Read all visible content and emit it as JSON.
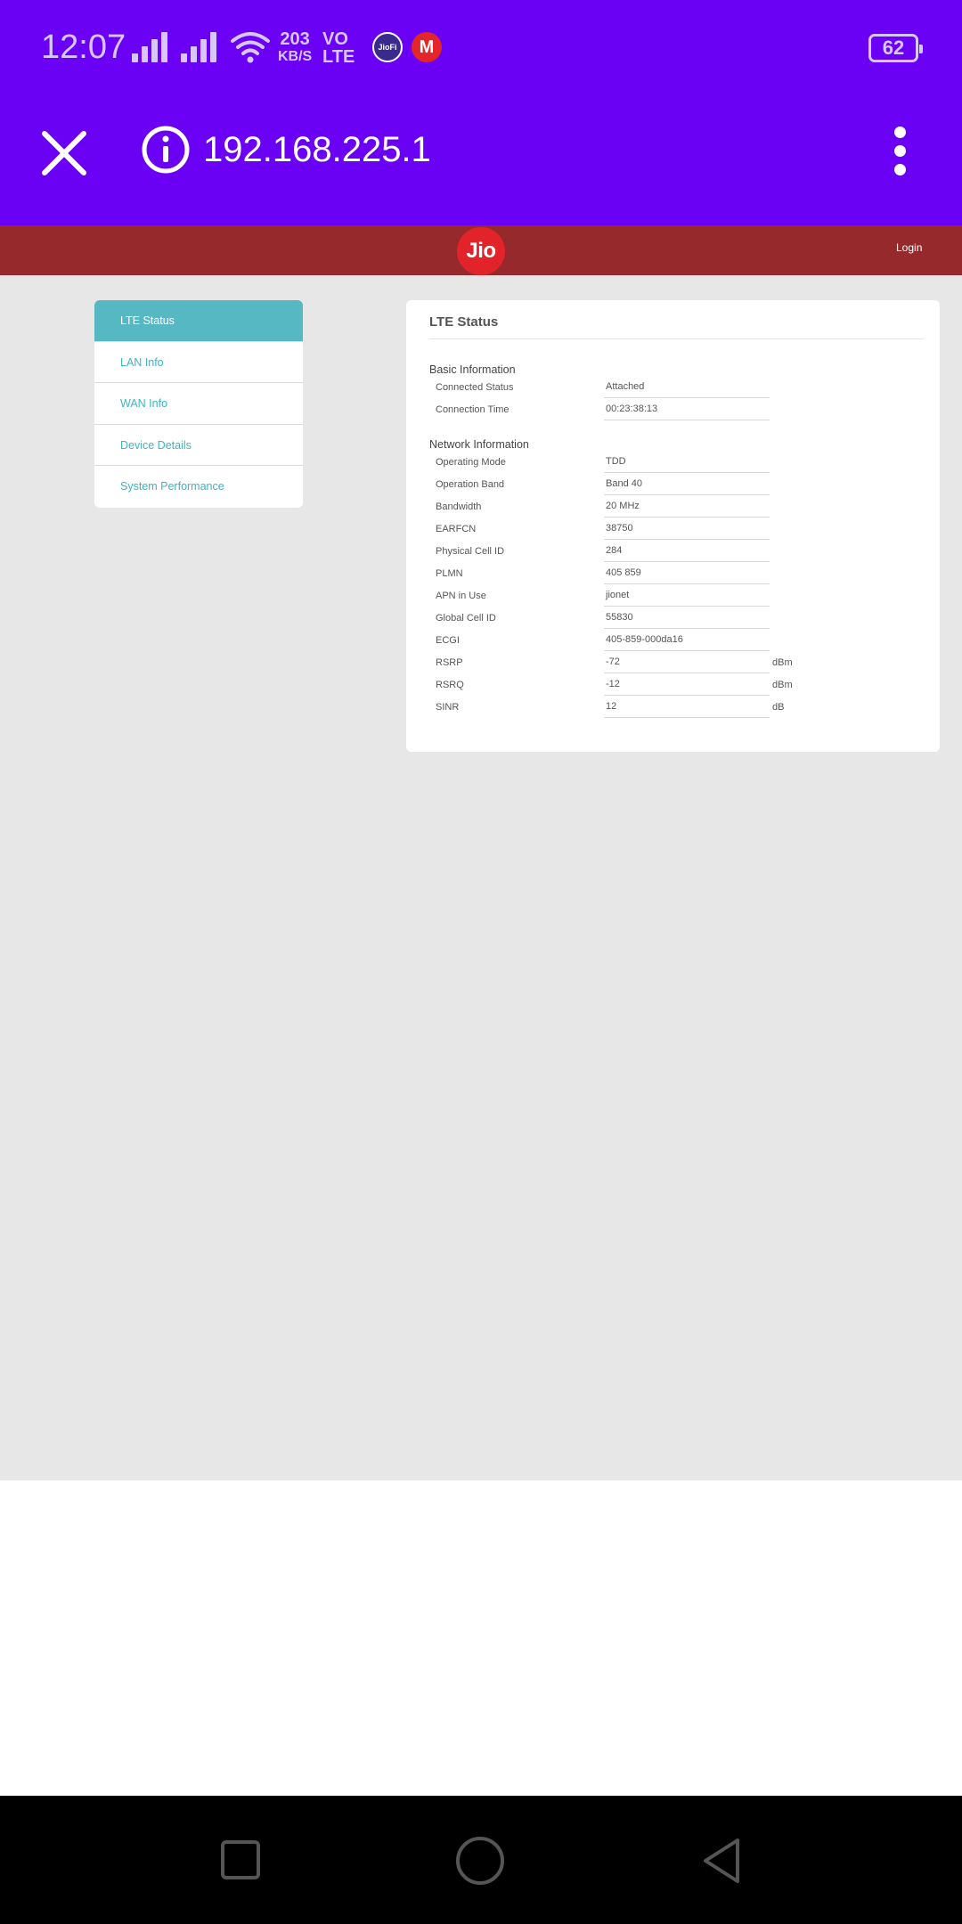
{
  "status_bar": {
    "time": "12:07",
    "net_speed_value": "203",
    "net_speed_unit": "KB/S",
    "volte_top": "VO",
    "volte_bottom": "LTE",
    "jiofi_label": "JioFi",
    "mega_label": "M",
    "battery": "62"
  },
  "browser": {
    "url": "192.168.225.1"
  },
  "header": {
    "logo_text": "Jio",
    "login_label": "Login"
  },
  "sidebar": {
    "items": [
      {
        "label": "LTE Status",
        "active": true
      },
      {
        "label": "LAN Info",
        "active": false
      },
      {
        "label": "WAN Info",
        "active": false
      },
      {
        "label": "Device Details",
        "active": false
      },
      {
        "label": "System Performance",
        "active": false
      }
    ]
  },
  "panel": {
    "title": "LTE Status",
    "basic": {
      "title": "Basic Information",
      "rows": [
        {
          "label": "Connected Status",
          "value": "Attached",
          "unit": ""
        },
        {
          "label": "Connection Time",
          "value": "00:23:38:13",
          "unit": ""
        }
      ]
    },
    "network": {
      "title": "Network Information",
      "rows": [
        {
          "label": "Operating Mode",
          "value": "TDD",
          "unit": ""
        },
        {
          "label": "Operation Band",
          "value": "Band 40",
          "unit": ""
        },
        {
          "label": "Bandwidth",
          "value": "20 MHz",
          "unit": ""
        },
        {
          "label": "EARFCN",
          "value": "38750",
          "unit": ""
        },
        {
          "label": "Physical Cell ID",
          "value": "284",
          "unit": ""
        },
        {
          "label": "PLMN",
          "value": "405 859",
          "unit": ""
        },
        {
          "label": "APN in Use",
          "value": "jionet",
          "unit": ""
        },
        {
          "label": "Global Cell ID",
          "value": "55830",
          "unit": ""
        },
        {
          "label": "ECGI",
          "value": "405-859-000da16",
          "unit": ""
        },
        {
          "label": "RSRP",
          "value": "-72",
          "unit": "dBm"
        },
        {
          "label": "RSRQ",
          "value": "-12",
          "unit": "dBm"
        },
        {
          "label": "SINR",
          "value": "12",
          "unit": "dB"
        }
      ]
    }
  },
  "colors": {
    "chrome": "#6a00f4",
    "header": "#96292b",
    "accent": "#55b8c3",
    "logo": "#e3232a"
  }
}
